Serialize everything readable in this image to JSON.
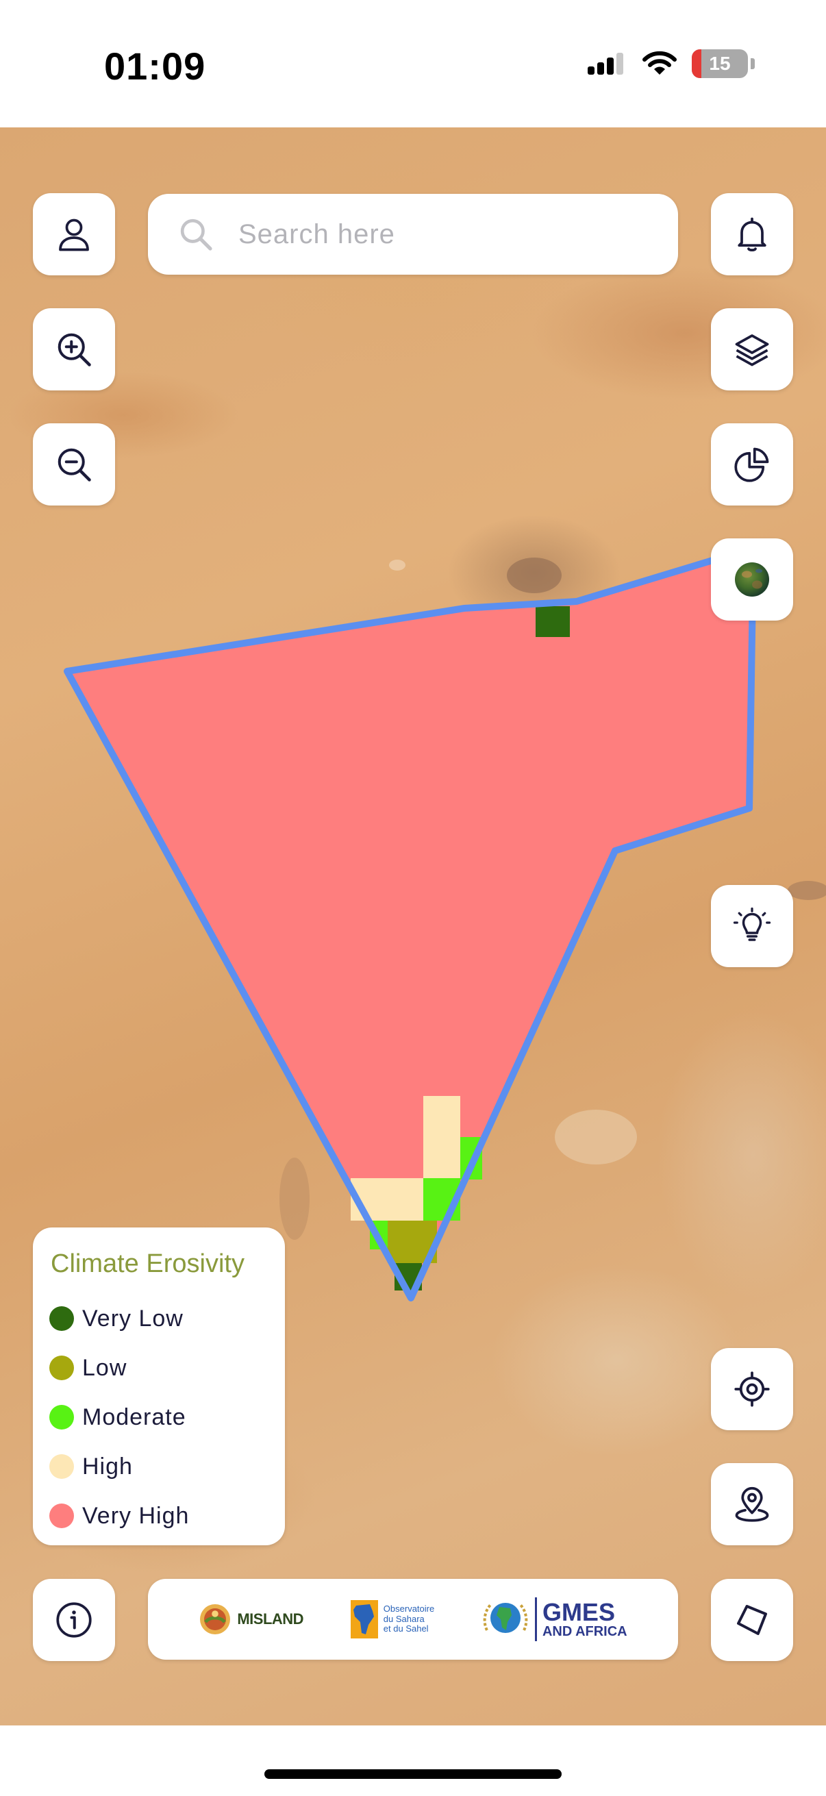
{
  "status_bar": {
    "time": "01:09",
    "battery_level": "15",
    "icons": [
      "cellular-signal-icon",
      "wifi-icon",
      "battery-icon"
    ]
  },
  "search": {
    "placeholder": "Search here"
  },
  "map": {
    "layer": "Climate Erosivity",
    "basemap": "satellite",
    "boundary_color": "#5b8ff0",
    "fill_color": "#fe7e7e"
  },
  "left_controls": [
    "profile-icon",
    "zoom-in-icon",
    "zoom-out-icon",
    "info-icon"
  ],
  "right_controls": [
    "bell-icon",
    "layers-icon",
    "pie-chart-icon",
    "globe-icon",
    "lightbulb-icon",
    "locate-icon",
    "map-pin-icon",
    "polygon-icon"
  ],
  "legend": {
    "title": "Climate Erosivity",
    "items": [
      {
        "label": "Very Low",
        "color": "#2e6b0f"
      },
      {
        "label": "Low",
        "color": "#a6a80e"
      },
      {
        "label": "Moderate",
        "color": "#58f214"
      },
      {
        "label": "High",
        "color": "#fde7b5"
      },
      {
        "label": "Very High",
        "color": "#fe7e7e"
      }
    ]
  },
  "logos": {
    "misland": "MISLAND",
    "oss_line1": "Observatoire",
    "oss_line2": "du Sahara",
    "oss_line3": "et du Sahel",
    "gmes_line1": "GMES",
    "gmes_line2": "AND AFRICA"
  }
}
